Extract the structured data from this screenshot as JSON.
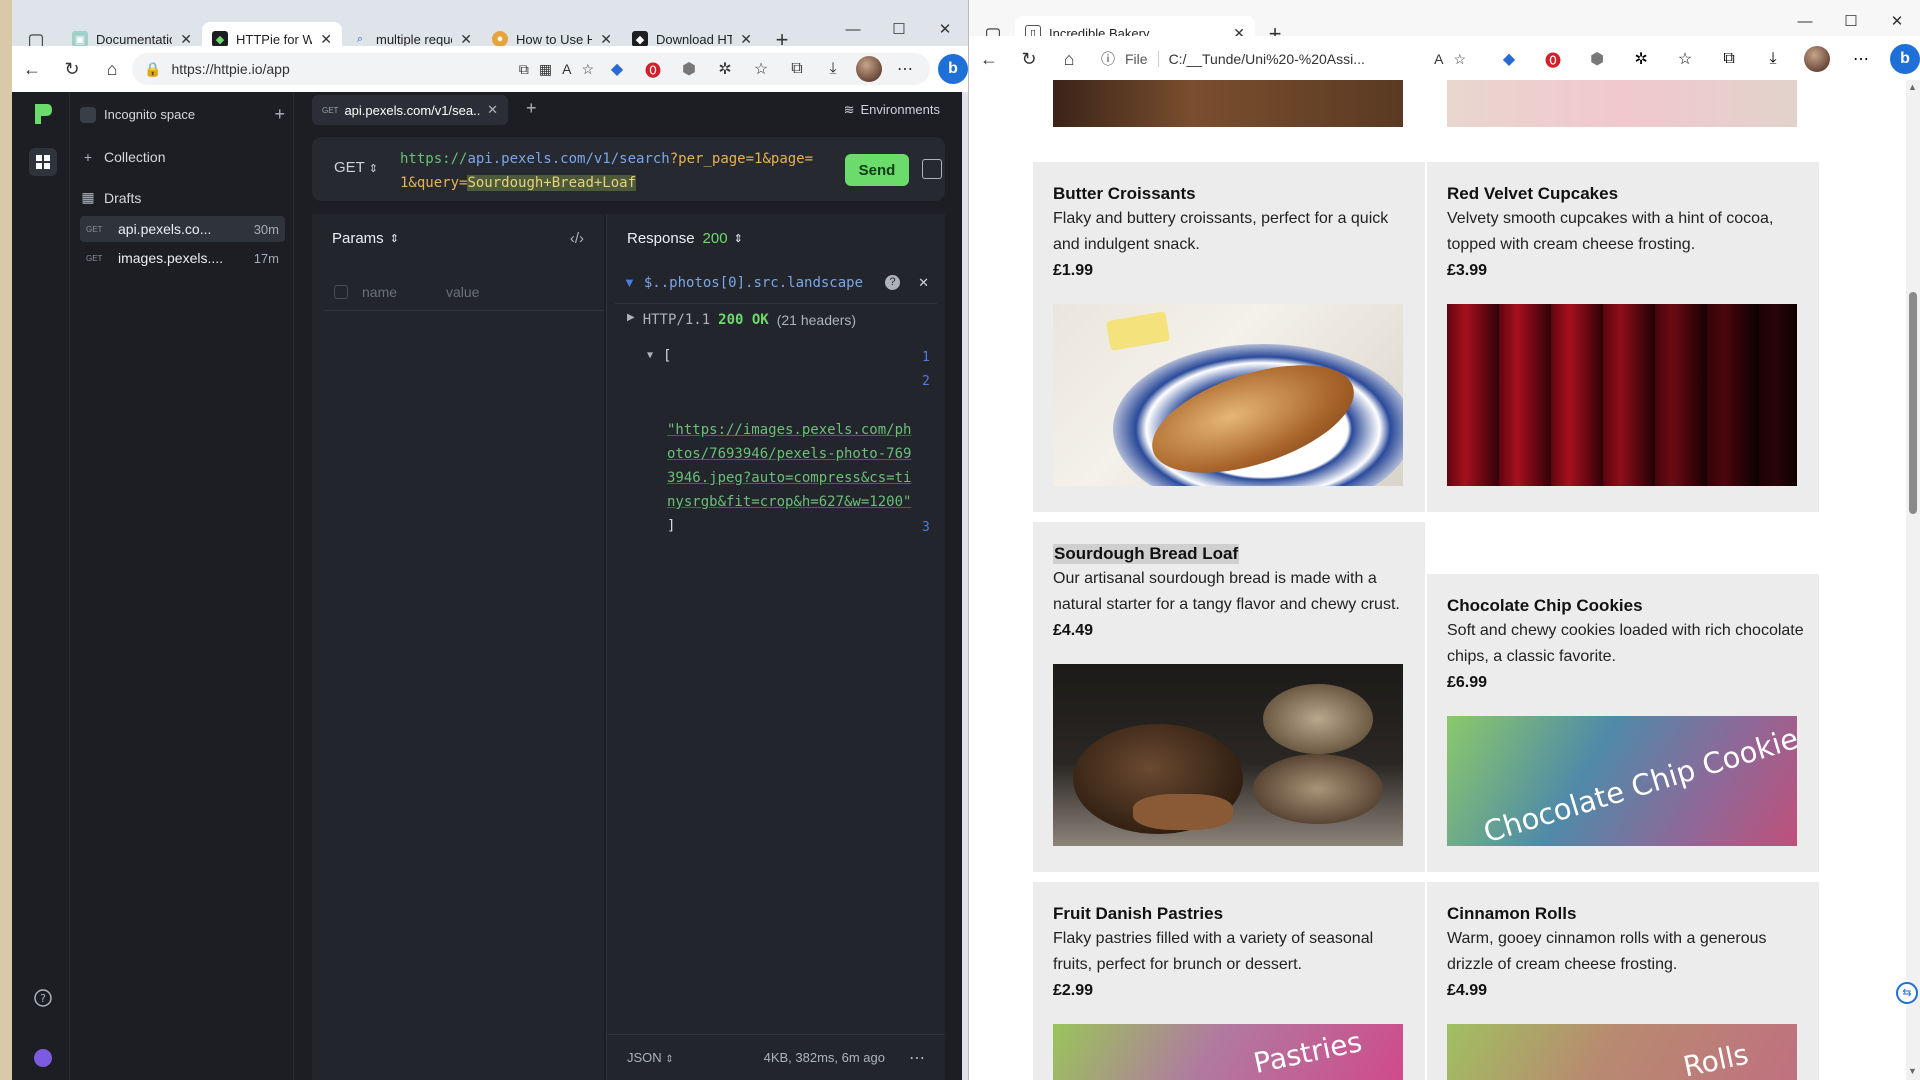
{
  "left_browser": {
    "tabs": [
      {
        "title": "Documentatio",
        "icon": "doc-icon"
      },
      {
        "title": "HTTPie for Web",
        "icon": "httpie-icon",
        "active": true
      },
      {
        "title": "multiple reque",
        "icon": "search-icon"
      },
      {
        "title": "How to Use H",
        "icon": "globe-icon"
      },
      {
        "title": "Download HT",
        "icon": "httpie-icon"
      }
    ],
    "address": "https://httpie.io/app"
  },
  "httpie": {
    "space": "Incognito space",
    "collection_label": "Collection",
    "drafts_label": "Drafts",
    "drafts": [
      {
        "method": "GET",
        "name": "api.pexels.co...",
        "age": "30m"
      },
      {
        "method": "GET",
        "name": "images.pexels....",
        "age": "17m"
      }
    ],
    "request_tab": {
      "method": "GET",
      "name": "api.pexels.com/v1/sea..."
    },
    "environments": "Environments",
    "method": "GET",
    "url": {
      "scheme": "https://",
      "host": "api.pexels.com",
      "path": "/v1/search",
      "q1": "?per_page=1&page=1&query=",
      "highlight": "Sourdough+Bread+Loaf"
    },
    "send": "Send",
    "params_title": "Params",
    "param_name_placeholder": "name",
    "param_value_placeholder": "value",
    "response_title": "Response",
    "response_code": "200",
    "filter": "$..photos[0].src.landscape",
    "status_line": {
      "proto": "HTTP/1.1",
      "code": "200 OK",
      "headers": "(21 headers)"
    },
    "json_lines": [
      "[",
      "\"https://images.pexels.com/photos/7693946/pexels-photo-7693946.jpeg?auto=compress&cs=tinysrgb&fit=crop&h=627&w=1200\"",
      "]"
    ],
    "line_numbers": [
      "1",
      "2",
      "3"
    ],
    "format": "JSON",
    "footer": "4KB, 382ms, 6m ago"
  },
  "right_browser": {
    "tab_title": "Incredible Bakery",
    "address_prefix": "File",
    "address": "C:/__Tunde/Uni%20-%20Assi..."
  },
  "bakery": {
    "products": [
      {
        "name": "Butter Croissants",
        "desc": "Flaky and buttery croissants, perfect for a quick and indulgent snack.",
        "price": "£1.99"
      },
      {
        "name": "Red Velvet Cupcakes",
        "desc": "Velvety smooth cupcakes with a hint of cocoa, topped with cream cheese frosting.",
        "price": "£3.99"
      },
      {
        "name": "Sourdough Bread Loaf",
        "desc": "Our artisanal sourdough bread is made with a natural starter for a tangy flavor and chewy crust.",
        "price": "£4.49"
      },
      {
        "name": "Chocolate Chip Cookies",
        "desc": "Soft and chewy cookies loaded with rich chocolate chips, a classic favorite.",
        "price": "£6.99",
        "image_text": "Chocolate Chip Cookies"
      },
      {
        "name": "Fruit Danish Pastries",
        "desc": "Flaky pastries filled with a variety of seasonal fruits, perfect for brunch or dessert.",
        "price": "£2.99",
        "image_text": "Pastries"
      },
      {
        "name": "Cinnamon Rolls",
        "desc": "Warm, gooey cinnamon rolls with a generous drizzle of cream cheese frosting.",
        "price": "£4.99",
        "image_text": "Rolls"
      }
    ]
  }
}
